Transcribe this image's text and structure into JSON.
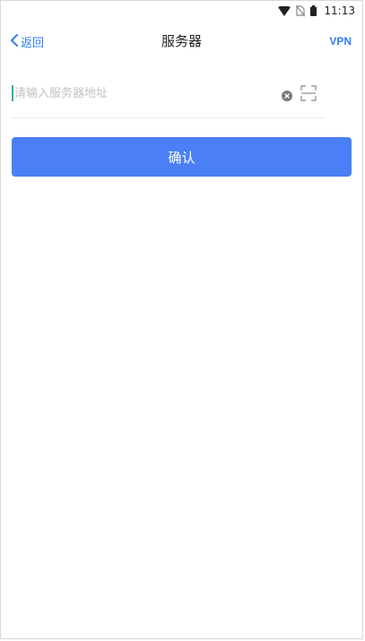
{
  "status_bar": {
    "time": "11:13",
    "icons": [
      "wifi-icon",
      "no-sim-icon",
      "battery-icon"
    ]
  },
  "nav": {
    "back_label": "返回",
    "title": "服务器",
    "right_action": "VPN"
  },
  "form": {
    "server_input": {
      "placeholder": "请输入服务器地址",
      "value": ""
    },
    "confirm_label": "确认"
  },
  "colors": {
    "accent": "#2f7ef5",
    "button": "#4a7ff6",
    "caret": "#2bb3a0"
  }
}
